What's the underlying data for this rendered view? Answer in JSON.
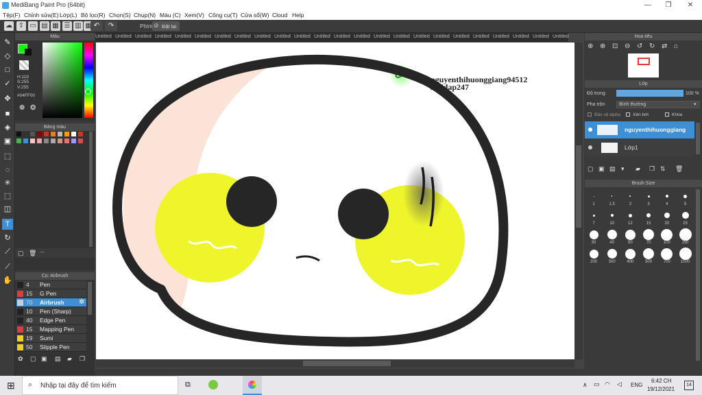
{
  "window": {
    "title": "MediBang Paint Pro (64bit)"
  },
  "menu": [
    "Tệp(F)",
    "Chỉnh sửa(E)",
    "Lớp(L)",
    "Bộ lọc(R)",
    "Chọn(S)",
    "Chụp(N)",
    "Màu (C)",
    "Xem(V)",
    "Công cụ(T)",
    "Cửa sổ(W)",
    "Cloud",
    "Help"
  ],
  "toolbar": {
    "shortcut_label": "Phím",
    "reset_label": "Đặt lại"
  },
  "color_panel": {
    "title": "Màu",
    "h": "H:119",
    "s": "S:255",
    "v": "V:255",
    "hex": "#04FF00",
    "current_color": "#04FF00"
  },
  "palette_panel": {
    "title": "Bảng màu",
    "footer": "---"
  },
  "brush_panel": {
    "title": "Cọ: Airbrush",
    "brushes": [
      {
        "size": "4",
        "name": "Pen",
        "color": "#222222"
      },
      {
        "size": "15",
        "name": "G Pen",
        "color": "#e23b3b"
      },
      {
        "size": "70",
        "name": "Airbrush",
        "color": "#cccccc"
      },
      {
        "size": "10",
        "name": "Pen (Sharp)",
        "color": "#222222"
      },
      {
        "size": "40",
        "name": "Edge Pen",
        "color": "#222222"
      },
      {
        "size": "15",
        "name": "Mapping Pen",
        "color": "#e23b3b"
      },
      {
        "size": "19",
        "name": "Sumi",
        "color": "#f0d020"
      },
      {
        "size": "50",
        "name": "Stipple Pen",
        "color": "#f0d020"
      }
    ]
  },
  "tabs": [
    "Untitled",
    "Untitled",
    "Untitled",
    "Untitled",
    "Untitled",
    "Untitled",
    "Untitled",
    "Untitled",
    "Untitled",
    "Untitled",
    "Untitled",
    "Untitled",
    "Untitled",
    "Untitled",
    "Untitled",
    "Untitled",
    "Untitled",
    "Untitled",
    "Untitled",
    "Untitled",
    "Untitled",
    "Untitled",
    "Untitled",
    "Untitled"
  ],
  "canvas": {
    "watermark_line1": "nguyenthihuonggiang94512",
    "watermark_line2": "Hoidap247"
  },
  "navigator_panel": {
    "title": "Hoa tiêu"
  },
  "layer_panel": {
    "title": "Lớp",
    "opacity_label": "Độ trong",
    "opacity_value": "100 %",
    "blend_label": "Pha trộn",
    "blend_value": "Bình thường",
    "protect_alpha": "Bảo vệ alpha",
    "clipping": "Xén bớt",
    "lock": "Khóa",
    "layers": [
      {
        "name": "nguyenthihuonggiang"
      },
      {
        "name": "Lớp1"
      }
    ]
  },
  "brush_size_panel": {
    "title": "Brush Size",
    "sizes": [
      "1",
      "1.5",
      "2",
      "3",
      "4",
      "5",
      "7",
      "10",
      "12",
      "15",
      "20",
      "25",
      "30",
      "40",
      "50",
      "70",
      "100",
      "150",
      "200",
      "300",
      "400",
      "500",
      "700",
      "1000"
    ]
  },
  "taskbar": {
    "search_placeholder": "Nhập tại đây để tìm kiếm",
    "language": "ENG",
    "time": "6:42 CH",
    "date": "19/12/2021",
    "notifications": "14"
  }
}
